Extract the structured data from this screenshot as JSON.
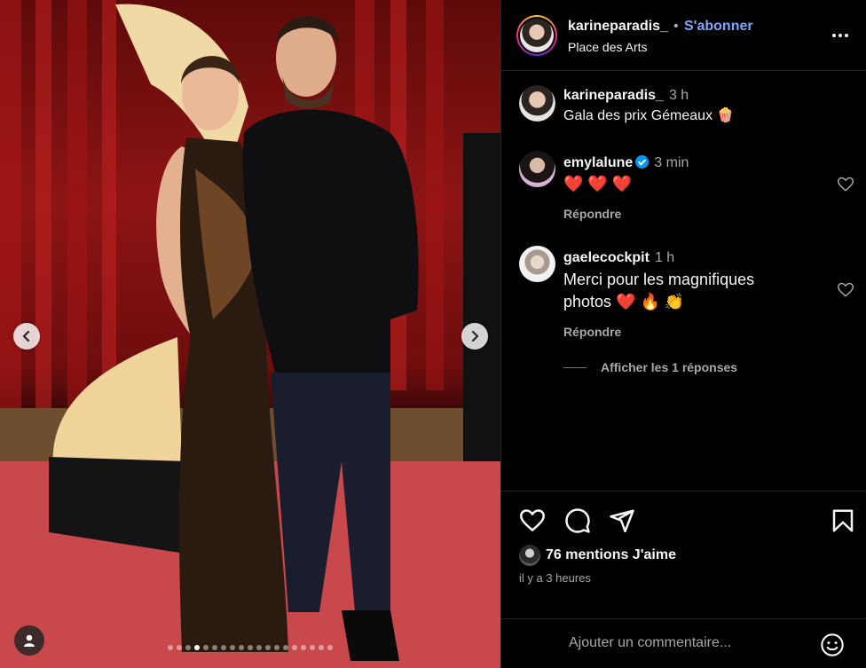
{
  "post": {
    "username": "karineparadis_",
    "separator": "•",
    "follow_label": "S'abonner",
    "location": "Place des Arts",
    "more_icon": "more-horizontal-icon"
  },
  "photo": {
    "carousel_total": 19,
    "carousel_index": 3
  },
  "comments": [
    {
      "username": "karineparadis_",
      "time": "3 h",
      "text": "Gala des prix Gémeaux 🍿",
      "verified": false
    },
    {
      "username": "emylalune",
      "time": "3 min",
      "text": "❤️ ❤️ ❤️",
      "verified": true,
      "reply_label": "Répondre"
    },
    {
      "username": "gaelecockpit",
      "time": "1 h",
      "text_line1": "Merci pour les magnifiques",
      "text_line2": "photos ❤️ 🔥 👏",
      "verified": false,
      "reply_label": "Répondre"
    }
  ],
  "view_replies_label": "Afficher les 1 réponses",
  "likes": {
    "count_label": "76 mentions J'aime"
  },
  "post_age": "il y a 3 heures",
  "add_comment": {
    "placeholder": "Ajouter un commentaire..."
  },
  "colors": {
    "follow": "#7ea6ff",
    "verified": "#0095f6",
    "panel_bg": "#000000"
  }
}
